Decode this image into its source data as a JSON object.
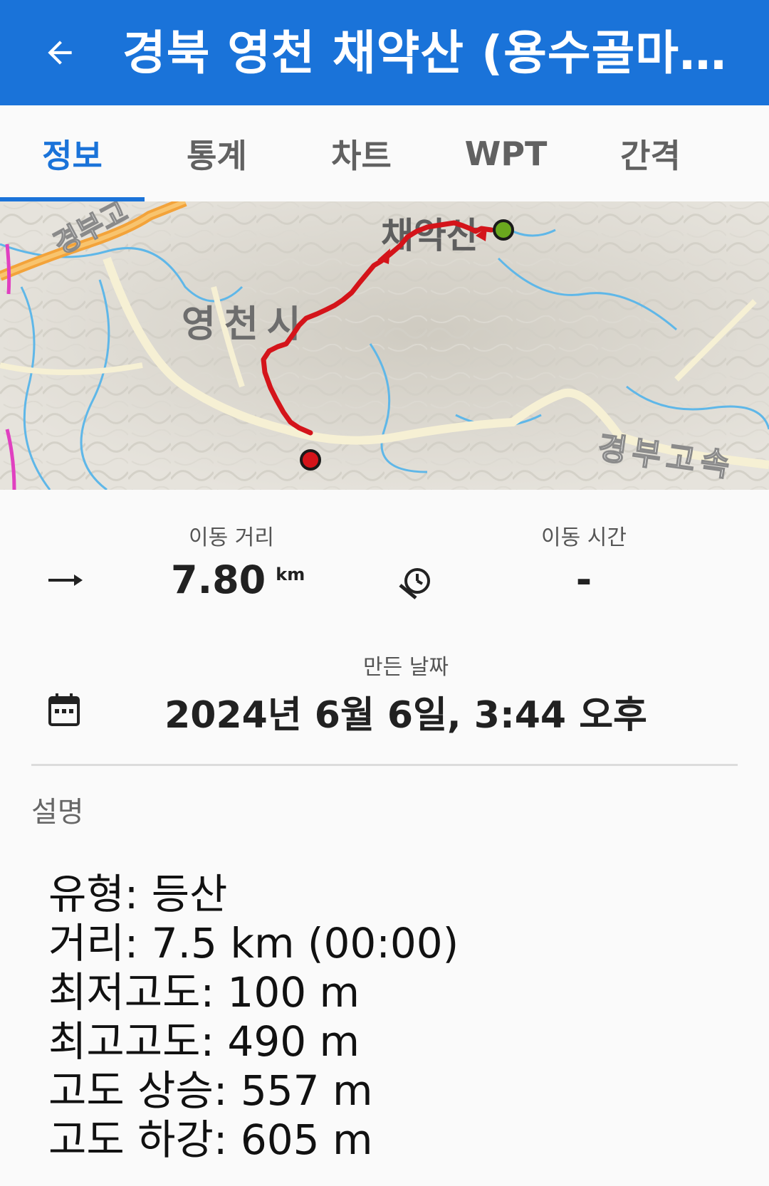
{
  "app_bar": {
    "title": "경북 영천 채약산 (용수골마...",
    "back_icon": "arrow-left-icon"
  },
  "tabs": [
    {
      "label": "정보",
      "active": true
    },
    {
      "label": "통계",
      "active": false
    },
    {
      "label": "차트",
      "active": false
    },
    {
      "label": "WPT",
      "active": false
    },
    {
      "label": "간격",
      "active": false
    }
  ],
  "map": {
    "labels": {
      "highway_top": "경부고",
      "city": "영천시",
      "mountain": "채약산",
      "highway_bottom": "경부고속"
    },
    "track_color": "#d4141a",
    "start_color": "#6aa81e",
    "end_color": "#d4141a"
  },
  "stats": {
    "distance": {
      "label": "이동 거리",
      "value": "7.80",
      "unit": "km",
      "icon": "arrow-right-icon"
    },
    "moving_time": {
      "label": "이동 시간",
      "value": "-",
      "icon": "timer-icon"
    },
    "created": {
      "label": "만든 날짜",
      "value": "2024년 6월 6일, 3:44 오후",
      "icon": "calendar-icon"
    }
  },
  "description": {
    "title": "설명",
    "lines": [
      "유형: 등산",
      "거리: 7.5 km (00:00)",
      "최저고도: 100 m",
      "최고고도: 490 m",
      "고도 상승: 557 m",
      "고도 하강: 605 m"
    ]
  },
  "colors": {
    "primary": "#1a73d9",
    "background": "#fafafa"
  }
}
